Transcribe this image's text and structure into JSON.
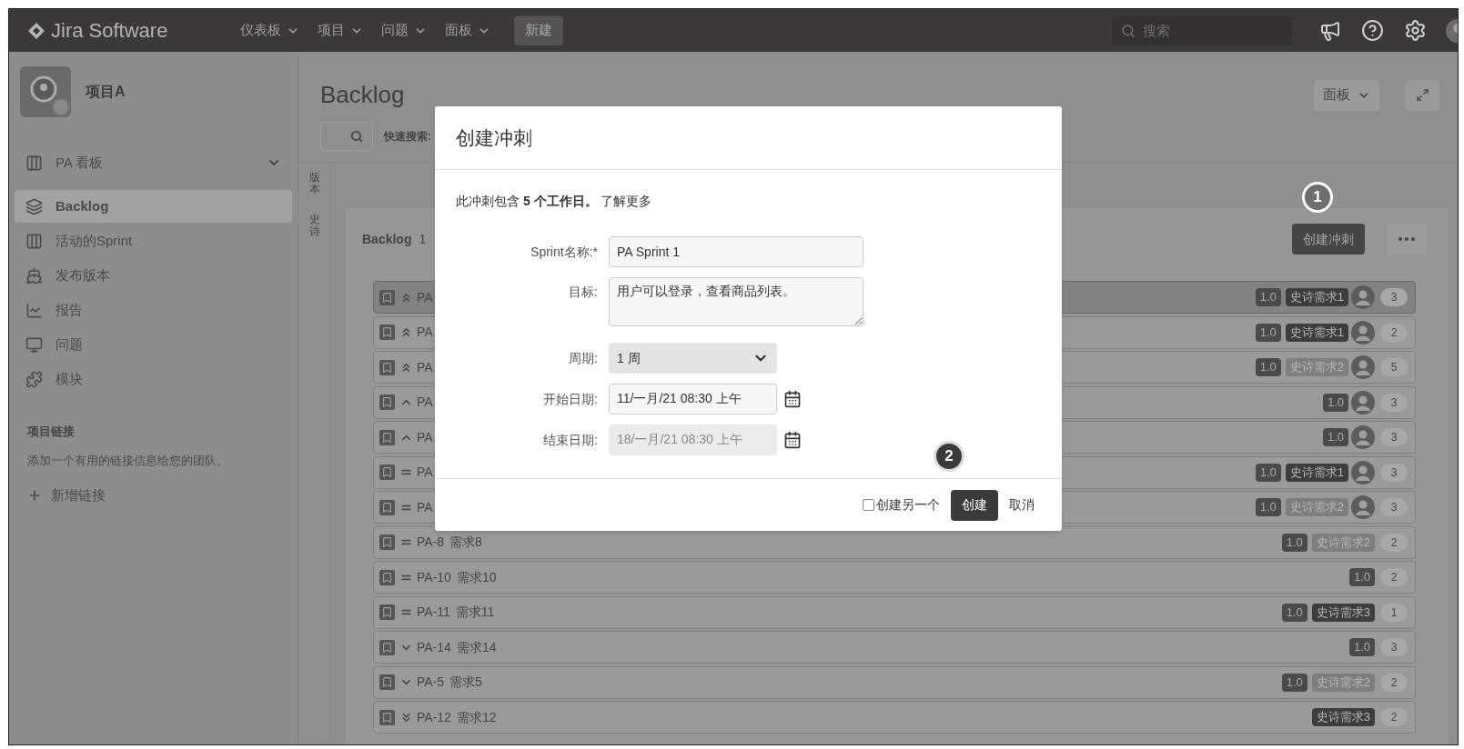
{
  "top_bar": {
    "logo": "Jira Software",
    "menus": [
      {
        "label": "仪表板"
      },
      {
        "label": "项目"
      },
      {
        "label": "问题"
      },
      {
        "label": "面板"
      }
    ],
    "create_button": "新建",
    "search": {
      "placeholder": "搜索"
    }
  },
  "sidebar": {
    "project": "项目A",
    "items": [
      {
        "label": "PA 看板",
        "expandable": true,
        "selected": false
      },
      {
        "label": "Backlog",
        "expandable": false,
        "selected": true
      },
      {
        "label": "活动的Sprint",
        "expandable": false,
        "selected": false
      },
      {
        "label": "发布版本",
        "expandable": false,
        "selected": false
      },
      {
        "label": "报告",
        "expandable": false,
        "selected": false
      },
      {
        "label": "问题",
        "expandable": false,
        "selected": false
      },
      {
        "label": "模块",
        "expandable": false,
        "selected": false
      }
    ],
    "links_heading": "项目链接",
    "links_text": "添加一个有用的链接信息给您的团队。",
    "add_link": "新增链接"
  },
  "page": {
    "title": "Backlog",
    "board_button": "面板",
    "quick_search_label": "快速搜索:",
    "side_tabs": [
      "版本",
      "史诗"
    ]
  },
  "backlog": {
    "title": "Backlog",
    "count": "1",
    "create_sprint_button": "创建冲刺",
    "rows": [
      {
        "key": "PA",
        "kind": "highest",
        "version": "1.0",
        "epic": {
          "label": "史诗需求1",
          "color": "#3d3d3d"
        },
        "avatar": true,
        "estimate": "3",
        "selected": true
      },
      {
        "key": "PA",
        "kind": "highest",
        "version": "1.0",
        "epic": {
          "label": "史诗需求1",
          "color": "#3d3d3d"
        },
        "avatar": true,
        "estimate": "2",
        "selected": false
      },
      {
        "key": "PA",
        "kind": "highest",
        "version": "1.0",
        "epic": {
          "label": "史诗需求2",
          "color": "#7e7e7e"
        },
        "avatar": true,
        "estimate": "5",
        "selected": false
      },
      {
        "key": "PA",
        "kind": "high",
        "version": "1.0",
        "avatar": true,
        "estimate": "3",
        "selected": false
      },
      {
        "key": "PA",
        "kind": "high",
        "version": "1.0",
        "avatar": true,
        "estimate": "3",
        "selected": false
      },
      {
        "key": "PA",
        "kind": "medium",
        "version": "1.0",
        "epic": {
          "label": "史诗需求1",
          "color": "#3d3d3d"
        },
        "avatar": true,
        "estimate": "3",
        "selected": false
      },
      {
        "key": "PA",
        "kind": "medium",
        "version": "1.0",
        "epic": {
          "label": "史诗需求2",
          "color": "#7e7e7e"
        },
        "avatar": true,
        "estimate": "3",
        "selected": false
      },
      {
        "key": "PA-8",
        "summary": "需求8",
        "kind": "medium",
        "version": "1.0",
        "epic": {
          "label": "史诗需求2",
          "color": "#7e7e7e"
        },
        "avatar": false,
        "estimate": "2",
        "selected": false
      },
      {
        "key": "PA-10",
        "summary": "需求10",
        "kind": "medium",
        "version": "1.0",
        "avatar": false,
        "estimate": "2",
        "selected": false
      },
      {
        "key": "PA-11",
        "summary": "需求11",
        "kind": "medium",
        "version": "1.0",
        "epic": {
          "label": "史诗需求3",
          "color": "#3d3d3d"
        },
        "avatar": false,
        "estimate": "1",
        "selected": false
      },
      {
        "key": "PA-14",
        "summary": "需求14",
        "kind": "low",
        "version": "1.0",
        "avatar": false,
        "estimate": "3",
        "selected": false
      },
      {
        "key": "PA-5",
        "summary": "需求5",
        "kind": "low",
        "version": "1.0",
        "epic": {
          "label": "史诗需求2",
          "color": "#7e7e7e"
        },
        "avatar": false,
        "estimate": "2",
        "selected": false
      },
      {
        "key": "PA-12",
        "summary": "需求12",
        "kind": "lowest",
        "epic": {
          "label": "史诗需求3",
          "color": "#3d3d3d"
        },
        "avatar": false,
        "estimate": "2",
        "selected": false
      }
    ]
  },
  "dialog": {
    "title": "创建冲刺",
    "info": "此冲刺包含 **5 个工作日。**",
    "learn_more": "了解更多",
    "fields": [
      {
        "label": "Sprint名称:*",
        "kind": "text",
        "value": "PA Sprint 1",
        "disabled": false
      },
      {
        "label": "目标:",
        "kind": "textarea",
        "value": "用户可以登录，查看商品列表。",
        "disabled": false
      },
      {
        "label": "周期:",
        "kind": "select",
        "value": "1 周",
        "disabled": false
      },
      {
        "label": "开始日期:",
        "kind": "date",
        "value": "11/一月/21 08:30 上午",
        "disabled": false
      },
      {
        "label": "结束日期:",
        "kind": "date",
        "value": "18/一月/21 08:30 上午",
        "disabled": true
      }
    ],
    "create_another": {
      "label": "创建另一个",
      "checked": false
    },
    "create_button": "创建",
    "cancel_button": "取消"
  },
  "annotations": [
    {
      "label": "1"
    },
    {
      "label": "2"
    }
  ]
}
